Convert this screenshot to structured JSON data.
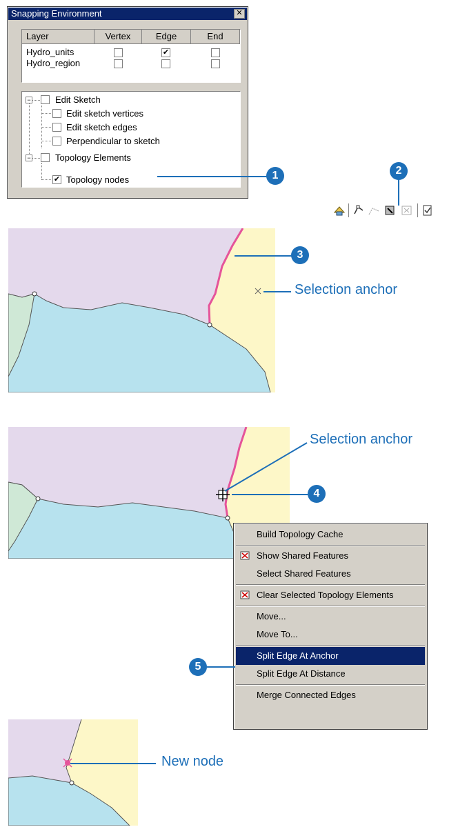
{
  "dialog": {
    "title": "Snapping Environment",
    "close_glyph": "✕",
    "columns": [
      "Layer",
      "Vertex",
      "Edge",
      "End"
    ],
    "rows": [
      {
        "layer": "Hydro_units",
        "vertex": "",
        "edge": "✔",
        "end": ""
      },
      {
        "layer": "Hydro_region",
        "vertex": "",
        "edge": "",
        "end": ""
      }
    ],
    "tree": [
      {
        "label": "Edit Sketch",
        "checked": ""
      },
      {
        "label": "Edit sketch vertices",
        "checked": ""
      },
      {
        "label": "Edit sketch edges",
        "checked": ""
      },
      {
        "label": "Perpendicular to sketch",
        "checked": ""
      },
      {
        "label": "Topology Elements",
        "checked": ""
      },
      {
        "label": "Topology nodes",
        "checked": "✔"
      }
    ],
    "expander_glyph": "−"
  },
  "callouts": {
    "c1": "1",
    "c2": "2",
    "c3": "3",
    "c4": "4",
    "c5": "5"
  },
  "toolbar": {
    "icons": [
      "topology-edit-icon",
      "modify-edge-icon",
      "reshape-edge-icon",
      "show-shared-features-icon",
      "fix-topology-error-icon",
      "error-inspector-icon"
    ]
  },
  "labels": {
    "selection_anchor_1": "Selection anchor",
    "selection_anchor_2": "Selection anchor",
    "new_node": "New node"
  },
  "menu": {
    "items": [
      {
        "label": "Build Topology Cache",
        "icon": ""
      },
      {
        "label": "Show Shared Features",
        "icon": "show-shared-features-icon"
      },
      {
        "label": "Select Shared Features",
        "icon": ""
      },
      {
        "label": "Clear Selected Topology Elements",
        "icon": "clear-selected-topology-icon"
      },
      {
        "label": "Move...",
        "icon": ""
      },
      {
        "label": "Move To...",
        "icon": ""
      },
      {
        "label": "Split Edge At Anchor",
        "icon": "",
        "selected": true
      },
      {
        "label": "Split Edge At Distance",
        "icon": ""
      },
      {
        "label": "Merge Connected Edges",
        "icon": ""
      }
    ]
  },
  "colors": {
    "accent": "#1d6fb8",
    "purple_area": "#e4d9ec",
    "blue_area": "#b7e2ee",
    "yellow_area": "#fdf7c8",
    "green_area": "#cfe8d6",
    "selected_edge": "#e5549a",
    "menu_highlight": "#0a246a"
  }
}
